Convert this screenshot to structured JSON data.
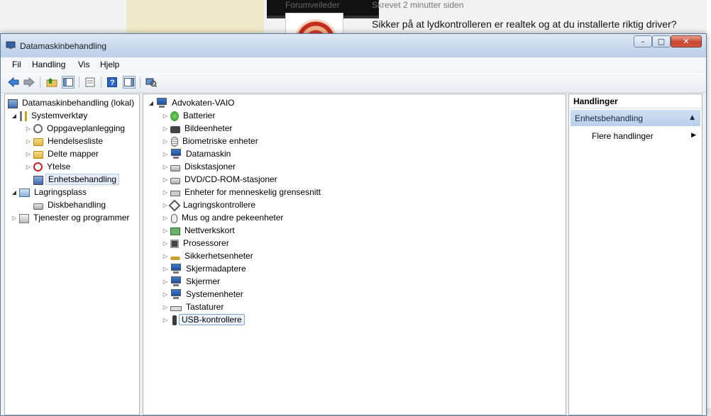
{
  "background": {
    "author_label": "Forumveileder",
    "time_label": "Skrevet 2 minutter siden",
    "post_text": "Sikker på at lydkontrolleren er realtek og at du installerte riktig driver?"
  },
  "window": {
    "title": "Datamaskinbehandling",
    "controls": {
      "minimize": "–",
      "maximize": "□",
      "close": "✕"
    }
  },
  "menubar": {
    "items": [
      "Fil",
      "Handling",
      "Vis",
      "Hjelp"
    ]
  },
  "left_tree": {
    "root": "Datamaskinbehandling (lokal)",
    "system_tools": "Systemverktøy",
    "system_tools_children": [
      "Oppgaveplanlegging",
      "Hendelsesliste",
      "Delte mapper",
      "Ytelse",
      "Enhetsbehandling"
    ],
    "storage": "Lagringsplass",
    "storage_children": [
      "Diskbehandling"
    ],
    "services": "Tjenester og programmer"
  },
  "device_tree": {
    "root": "Advokaten-VAIO",
    "categories": [
      "Batterier",
      "Bildeenheter",
      "Biometriske enheter",
      "Datamaskin",
      "Diskstasjoner",
      "DVD/CD-ROM-stasjoner",
      "Enheter for menneskelig grensesnitt",
      "Lagringskontrollere",
      "Mus og andre pekeenheter",
      "Nettverkskort",
      "Prosessorer",
      "Sikkerhetsenheter",
      "Skjermadaptere",
      "Skjermer",
      "Systemenheter",
      "Tastaturer",
      "USB-kontrollere"
    ]
  },
  "actions_pane": {
    "header": "Handlinger",
    "section": "Enhetsbehandling",
    "more": "Flere handlinger"
  },
  "colors": {
    "accent": "#c5d8ef",
    "titlebar": "#c6d7ec",
    "close_button": "#c9452f"
  }
}
